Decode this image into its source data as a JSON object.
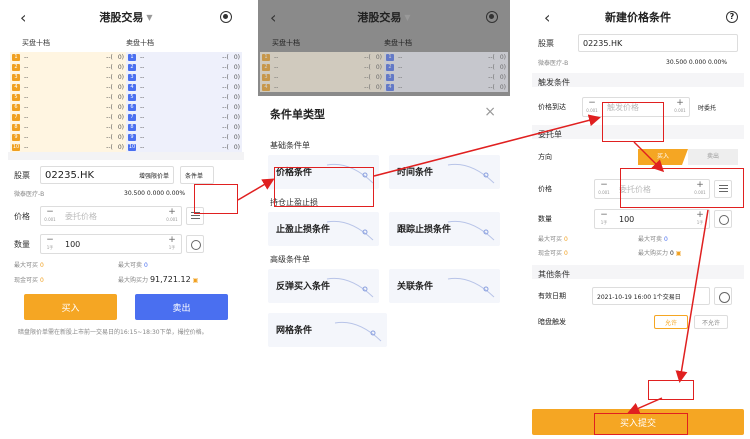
{
  "panel1": {
    "title": "港股交易",
    "bid_header": "买盘十档",
    "ask_header": "卖盘十档",
    "levels": [
      "1",
      "2",
      "3",
      "4",
      "5",
      "6",
      "7",
      "8",
      "9",
      "10"
    ],
    "dash": "--",
    "vol_dash": "--(",
    "zero": "0)",
    "stock_label": "股票",
    "stock_code": "02235.HK",
    "order_type": "增强限价单",
    "cond_btn": "条件单",
    "stock_name": "微泰医疗-B",
    "quote": "30.500  0.000  0.00%",
    "price_label": "价格",
    "price_ph": "委托价格",
    "step": "0.001",
    "qty_label": "数量",
    "qty_step": "1手",
    "qty": "100",
    "max_buy_label": "最大可买",
    "max_buy": "0",
    "max_sell_label": "最大可卖",
    "max_sell": "0",
    "cash_buy_label": "现金可买",
    "cash_buy": "0",
    "max_power_label": "最大购买力",
    "max_power": "91,721.12",
    "buy": "买入",
    "sell": "卖出",
    "note": "暗盘限价单需在新股上市前一交易日的16:15~18:30下单，撮控价格。"
  },
  "panel2": {
    "title": "港股交易",
    "bid_header": "买盘十档",
    "ask_header": "卖盘十档",
    "modal_title": "条件单类型",
    "groups": [
      {
        "name": "基础条件单",
        "items": [
          "价格条件",
          "时间条件"
        ]
      },
      {
        "name": "持仓止盈止损",
        "items": [
          "止盈止损条件",
          "跟踪止损条件"
        ]
      },
      {
        "name": "高级条件单",
        "items": [
          "反弹买入条件",
          "关联条件"
        ]
      },
      {
        "name": "",
        "items": [
          "网格条件"
        ]
      }
    ]
  },
  "panel3": {
    "title": "新建价格条件",
    "stock_label": "股票",
    "stock_code": "02235.HK",
    "stock_name": "微泰医疗-B",
    "quote": "30.500  0.000  0.00%",
    "trigger_section": "触发条件",
    "price_reach": "价格到达",
    "trigger_ph": "触发价格",
    "step": "0.001",
    "time_trigger": "时委托",
    "order_section": "委托单",
    "direction": "方向",
    "buy": "买入",
    "sell": "卖出",
    "price_label": "价格",
    "price_ph": "委托价格",
    "qty_label": "数量",
    "qty_step": "1手",
    "qty": "100",
    "max_buy_label": "最大可买",
    "max_buy": "0",
    "max_sell_label": "最大可卖",
    "max_sell": "0",
    "cash_buy_label": "现金可买",
    "cash_buy": "0",
    "max_power_label": "最大购买力",
    "max_power": "0",
    "other_section": "其他条件",
    "valid_label": "有效日期",
    "valid_value": "2021-10-19 16:00 1个交易日",
    "dark_label": "暗盘触发",
    "allow": "允许",
    "disallow": "不允许",
    "submit": "买入提交"
  }
}
